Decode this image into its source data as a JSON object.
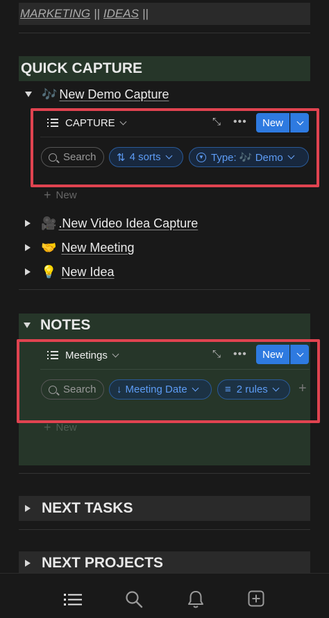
{
  "breadcrumb": {
    "part1": "MARKETING",
    "sep1": "||",
    "part2": "IDEAS",
    "sep2": "||"
  },
  "quick_capture": {
    "heading": "QUICK CAPTURE",
    "items": [
      {
        "emoji": "🎶",
        "label": "New Demo Capture",
        "expanded": true
      },
      {
        "emoji": "🎥",
        "label": ".New Video Idea Capture",
        "expanded": false
      },
      {
        "emoji": "🤝",
        "label": "New Meeting",
        "expanded": false
      },
      {
        "emoji": "💡",
        "label": "New Idea",
        "expanded": false
      }
    ],
    "db": {
      "title": "CAPTURE",
      "new_label": "New",
      "search_label": "Search",
      "sort_label": "4 sorts",
      "filter_label": "Type: 🎶 Demo",
      "add_new": "New"
    }
  },
  "notes": {
    "heading": "NOTES",
    "db": {
      "title": "Meetings",
      "new_label": "New",
      "search_label": "Search",
      "sort_label": "Meeting Date",
      "filter_label": "2 rules",
      "add_new": "New"
    }
  },
  "next_tasks": {
    "heading": "NEXT TASKS"
  },
  "next_projects": {
    "heading": "NEXT PROJECTS"
  },
  "colors": {
    "accent": "#2e7ae0",
    "section_green": "#263629",
    "highlight_red": "#e04350"
  },
  "icons": {
    "expand": "expand-arrows-icon",
    "more": "more-dots-icon",
    "bottom": [
      "list-icon",
      "search-icon",
      "bell-icon",
      "plus-square-icon"
    ]
  }
}
